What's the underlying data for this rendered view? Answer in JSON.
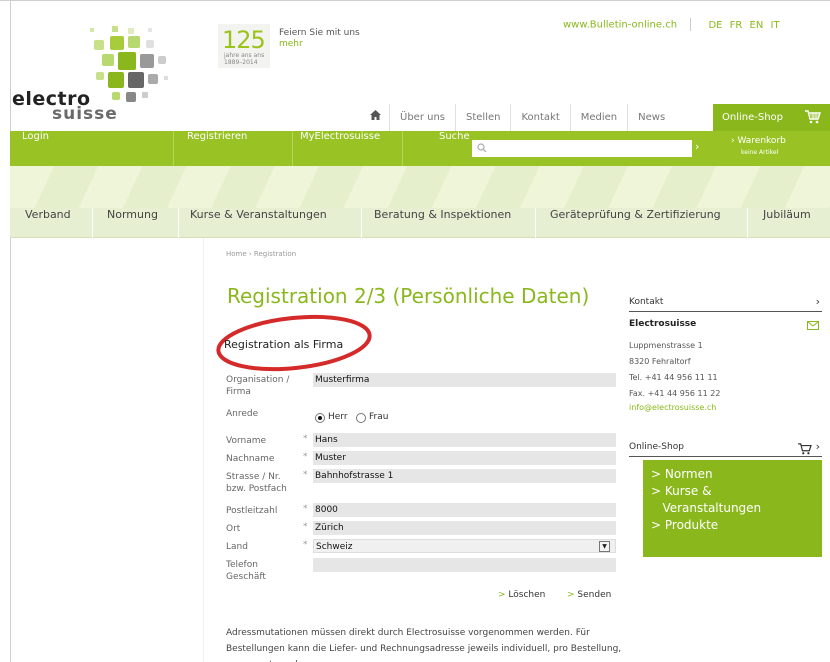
{
  "header": {
    "logo_text_1": "electro",
    "logo_text_2": "suisse",
    "jubilee_number": "125",
    "jubilee_small_1": "jahre ans ans",
    "jubilee_small_2": "1889–2014",
    "promo_text": "Feiern Sie mit uns",
    "promo_link": "mehr",
    "site_link": "www.Bulletin-online.ch",
    "languages": [
      "DE",
      "FR",
      "EN",
      "IT"
    ]
  },
  "topnav": {
    "home_icon": "home-icon",
    "items": [
      "Über uns",
      "Stellen",
      "Kontakt",
      "Medien",
      "News"
    ],
    "shop": "Online-Shop",
    "shop_icon": "cart-icon"
  },
  "greenbar": {
    "login": "Login",
    "register": "Registrieren",
    "my": "MyElectrosuisse",
    "search_label": "Suche",
    "search_placeholder": "",
    "cart_label": "› Warenkorb",
    "cart_sub": "keine Artikel"
  },
  "mainnav": [
    "Verband",
    "Normung",
    "Kurse & Veranstaltungen",
    "Beratung & Inspektionen",
    "Geräteprüfung & Zertifizierung",
    "Jubiläum"
  ],
  "breadcrumb": "Home  ›  Registration",
  "page_title": "Registration 2/3 (Persönliche Daten)",
  "section_title": "Registration als Firma",
  "form": {
    "org_label": "Organisation /\nFirma",
    "org_value": "Musterfirma",
    "anrede_label": "Anrede",
    "anrede_options": [
      "Herr",
      "Frau"
    ],
    "anrede_selected": "Herr",
    "vorname_label": "Vorname",
    "vorname_value": "Hans",
    "nachname_label": "Nachname",
    "nachname_value": "Muster",
    "strasse_label": "Strasse / Nr.\nbzw. Postfach",
    "strasse_value": "Bahnhofstrasse 1",
    "plz_label": "Postleitzahl",
    "plz_value": "8000",
    "ort_label": "Ort",
    "ort_value": "Zürich",
    "land_label": "Land",
    "land_value": "Schweiz",
    "telefon_label": "Telefon\nGeschäft",
    "telefon_value": "",
    "required_mark": "*",
    "delete_label": "Löschen",
    "send_label": "Senden",
    "chevron": ">"
  },
  "note": "Adressmutationen müssen direkt durch Electrosuisse vorgenommen werden. Für Bestellungen kann die Liefer- und Rechnungsadresse jeweils individuell, pro Bestellung, angepasst werden.",
  "sidebar": {
    "kontakt_title": "Kontakt",
    "company": "Electrosuisse",
    "street": "Luppmenstrasse 1",
    "city": "8320 Fehraltorf",
    "tel": "Tel. +41 44 956 11 11",
    "fax": "Fax. +41 44 956 11 22",
    "email": "info@electrosuisse.ch",
    "mail_icon": "mail-icon",
    "shop_title": "Online-Shop",
    "shop_items": [
      "> Normen",
      "> Kurse &",
      "   Veranstaltungen",
      "> Produkte"
    ]
  },
  "colors": {
    "brand_green": "#8ab81c",
    "bar_green": "#99c324",
    "nav_bg": "#e7efd3"
  }
}
